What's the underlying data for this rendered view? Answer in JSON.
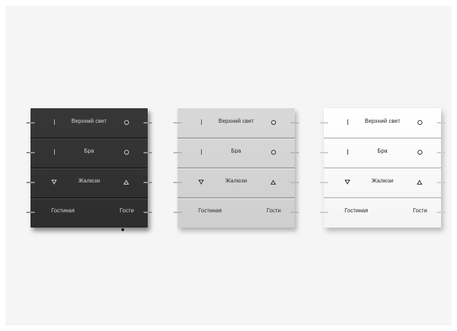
{
  "panels": [
    {
      "variant": "dark",
      "rows": [
        {
          "label": "Верхний свет"
        },
        {
          "label": "Бра"
        },
        {
          "label": "Жалюзи"
        },
        {
          "left": "Гостиная",
          "right": "Гости"
        }
      ]
    },
    {
      "variant": "grey",
      "rows": [
        {
          "label": "Верхний свет"
        },
        {
          "label": "Бра"
        },
        {
          "label": "Жалюзи"
        },
        {
          "left": "Гостиная",
          "right": "Гости"
        }
      ]
    },
    {
      "variant": "white",
      "rows": [
        {
          "label": "Верхний свет"
        },
        {
          "label": "Бра"
        },
        {
          "label": "Жалюзи"
        },
        {
          "left": "Гостиная",
          "right": "Гости"
        }
      ]
    }
  ],
  "colors": {
    "background": "#f5f5f5",
    "dark_panel": "#333333",
    "grey_panel": "#d4d4d4",
    "white_panel": "#fafafa"
  },
  "icons": {
    "row1_left": "bar-icon",
    "row1_right": "circle-icon",
    "row2_left": "bar-icon",
    "row2_right": "circle-icon",
    "row3_left": "triangle-down-icon",
    "row3_right": "triangle-up-icon"
  }
}
